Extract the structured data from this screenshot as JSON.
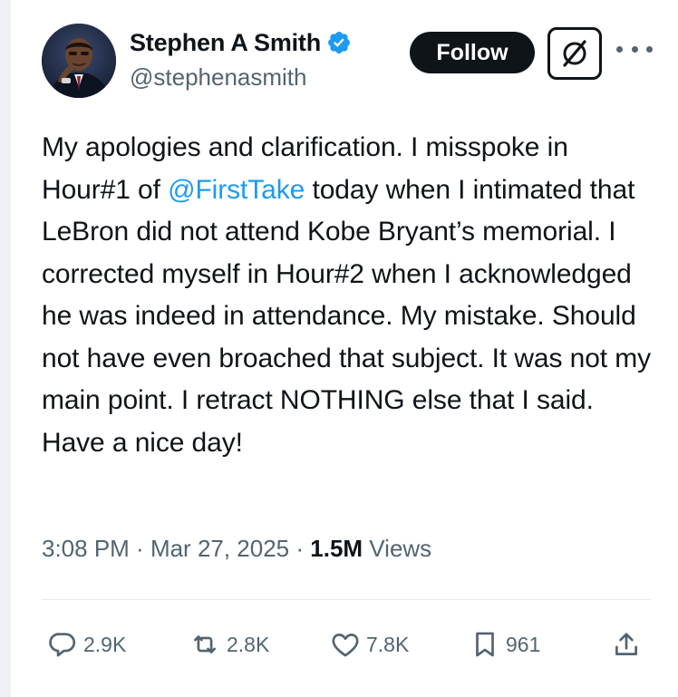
{
  "author": {
    "display_name": "Stephen A Smith",
    "handle": "@stephenasmith",
    "verified": true,
    "verified_color": "#1d9bf0"
  },
  "header": {
    "follow_label": "Follow",
    "grok_icon": "grok-icon",
    "more_icon": "more-icon"
  },
  "tweet": {
    "text_before": "My apologies and clarification. I misspoke in Hour#1 of ",
    "mention": "@FirstTake",
    "text_after": " today when I intimated that LeBron did not attend Kobe Bryant’s memorial. I corrected myself in Hour#2 when I acknowledged he was indeed in attendance. My mistake. Should not have even broached that subject. It was not my main point. I retract NOTHING else that I said. Have a nice day!",
    "link_color": "#1d9bf0"
  },
  "meta": {
    "time": "3:08 PM",
    "separator": " · ",
    "date": "Mar 27, 2025",
    "views_count": "1.5M",
    "views_label": " Views"
  },
  "actions": {
    "replies": "2.9K",
    "reposts": "2.8K",
    "likes": "7.8K",
    "bookmarks": "961"
  }
}
